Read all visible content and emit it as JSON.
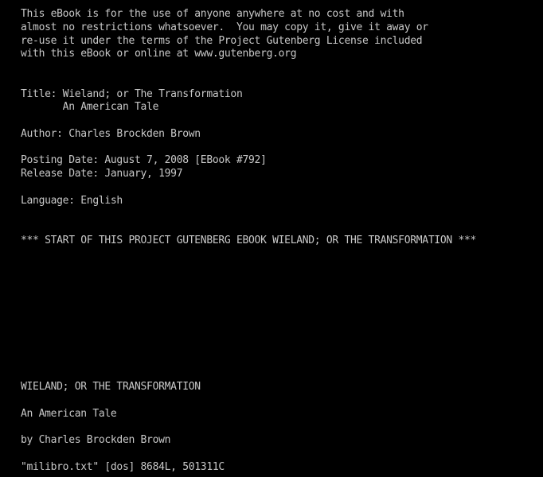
{
  "buffer": {
    "lines": [
      "This eBook is for the use of anyone anywhere at no cost and with",
      "almost no restrictions whatsoever.  You may copy it, give it away or",
      "re-use it under the terms of the Project Gutenberg License included",
      "with this eBook or online at www.gutenberg.org",
      "",
      "",
      "Title: Wieland; or The Transformation",
      "       An American Tale",
      "",
      "Author: Charles Brockden Brown",
      "",
      "Posting Date: August 7, 2008 [EBook #792]",
      "Release Date: January, 1997",
      "",
      "Language: English",
      "",
      "",
      "*** START OF THIS PROJECT GUTENBERG EBOOK WIELAND; OR THE TRANSFORMATION ***",
      "",
      "",
      "",
      "",
      "",
      "",
      "",
      "",
      "",
      "",
      "WIELAND; OR THE TRANSFORMATION",
      "",
      "An American Tale",
      "",
      "by Charles Brockden Brown"
    ]
  },
  "status_line": {
    "text": "\"milibro.txt\" [dos] 8684L, 501311C"
  },
  "colors": {
    "background": "#000000",
    "foreground": "#c8c8c8"
  }
}
